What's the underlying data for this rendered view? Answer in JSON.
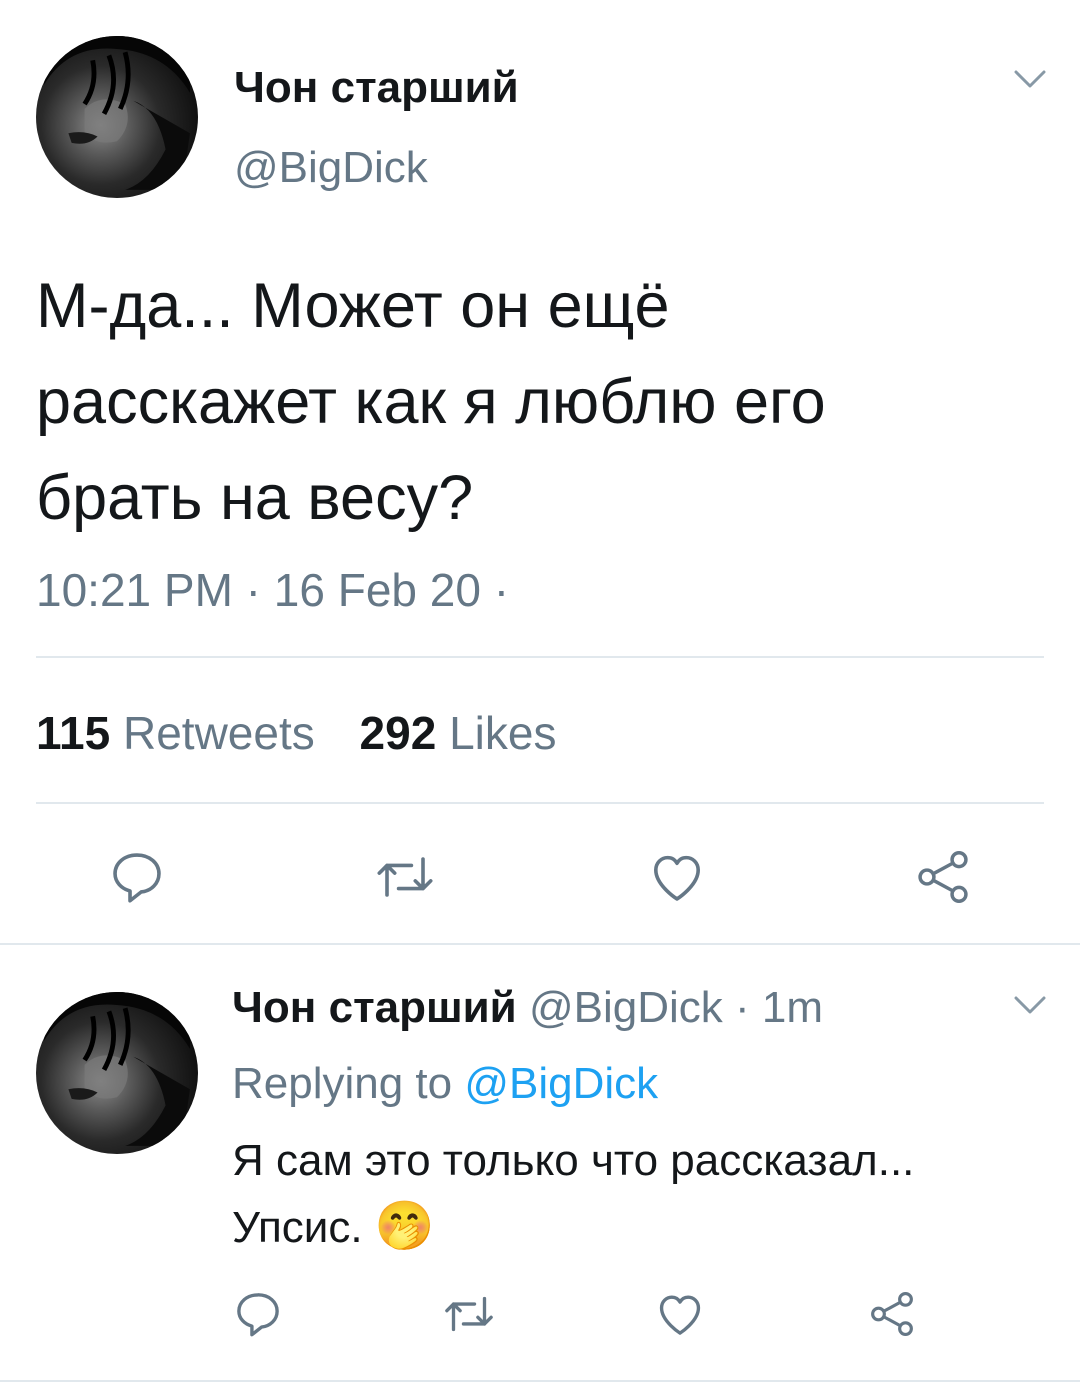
{
  "tweet": {
    "display_name": "Чон старший",
    "handle": "@BigDick",
    "text_line1": "М-да... Может он ещё",
    "text_line2": "расскажет как я люблю его",
    "text_line3": "брать на весу?",
    "meta": "10:21 PM · 16 Feb 20 ·",
    "retweets_count": "115",
    "retweets_label": "Retweets",
    "likes_count": "292",
    "likes_label": "Likes"
  },
  "reply": {
    "display_name": "Чон старший",
    "handle_time": "@BigDick · 1m",
    "replying_prefix": "Replying to",
    "replying_handle": "@BigDick",
    "text_line1": "Я сам это только что рассказал...",
    "text_line2": "Упсис.",
    "emoji": "🤭"
  },
  "icons": {
    "reply": "speech-bubble",
    "retweet": "retweet-arrows",
    "like": "heart",
    "share": "share-nodes",
    "menu": "chevron-down"
  },
  "colors": {
    "text": "#14171a",
    "secondary": "#657786",
    "link": "#1da1f2",
    "divider": "#e1e8ed",
    "icon": "#657786"
  }
}
